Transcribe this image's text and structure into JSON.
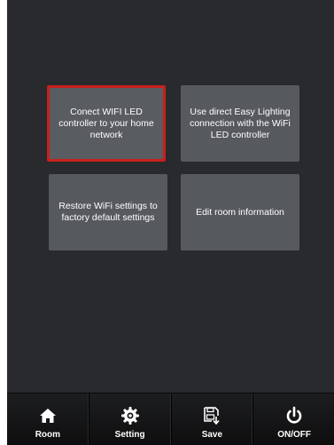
{
  "menu": {
    "tiles": [
      {
        "label": "Conect WIFI LED controller to your home network",
        "selected": true
      },
      {
        "label": "Use direct Easy Lighting connection with the WiFi LED controller",
        "selected": false
      },
      {
        "label": "Restore WiFi settings to factory default settings",
        "selected": false
      },
      {
        "label": "Edit room information",
        "selected": false
      }
    ]
  },
  "bottom_nav": {
    "items": [
      {
        "label": "Room",
        "icon": "home-icon"
      },
      {
        "label": "Setting",
        "icon": "gear-icon"
      },
      {
        "label": "Save",
        "icon": "save-icon"
      },
      {
        "label": "ON/OFF",
        "icon": "power-icon"
      }
    ]
  },
  "colors": {
    "background": "#282a2d",
    "tile": "#56595d",
    "selected_border": "#c8201c"
  }
}
